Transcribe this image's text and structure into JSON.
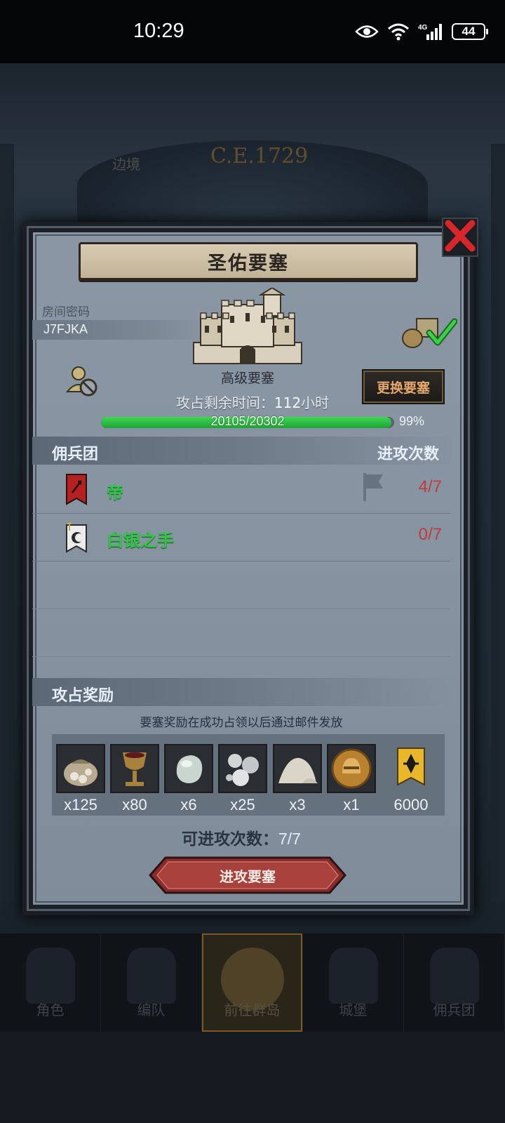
{
  "status_bar": {
    "time": "10:29",
    "battery": "44"
  },
  "background": {
    "year": "C.E.1729",
    "region_label": "边境"
  },
  "bottom_nav": [
    {
      "label": "角色",
      "active": false
    },
    {
      "label": "编队",
      "active": false
    },
    {
      "label": "前往群岛",
      "active": true
    },
    {
      "label": "城堡",
      "active": false
    },
    {
      "label": "佣兵团",
      "active": false
    }
  ],
  "modal": {
    "title": "圣佑要塞",
    "room_label": "房间密码",
    "room_code": "J7FJKA",
    "fortress_type": "高级要塞",
    "change_button": "更换要塞",
    "time_label": "攻占剩余时间：",
    "time_value": "112",
    "time_unit": "小时",
    "progress_text": "20105/20302",
    "progress_percent": "99%",
    "progress_fraction": 0.99,
    "mercenary_header": "佣兵团",
    "attacks_header": "进攻次数",
    "mercenaries": [
      {
        "name": "帝",
        "count": "4/7",
        "banner_color": "#b52020"
      },
      {
        "name": "白银之手",
        "count": "0/7",
        "banner_color": "#e9e9e9"
      }
    ],
    "reward_header": "攻占奖励",
    "reward_note": "要塞奖励在成功占领以后通过邮件发放",
    "rewards": [
      {
        "icon": "ore-sack-icon",
        "qty": "x125"
      },
      {
        "icon": "goblet-icon",
        "qty": "x80"
      },
      {
        "icon": "pearl-icon",
        "qty": "x6"
      },
      {
        "icon": "silver-orbs-icon",
        "qty": "x25"
      },
      {
        "icon": "powder-pile-icon",
        "qty": "x3"
      },
      {
        "icon": "gold-helmet-coin-icon",
        "qty": "x1"
      },
      {
        "icon": "guild-banner-icon",
        "qty": "6000"
      }
    ],
    "attempts_label": "可进攻次数：",
    "attempts_value": "7/7",
    "attack_button": "进攻要塞"
  }
}
